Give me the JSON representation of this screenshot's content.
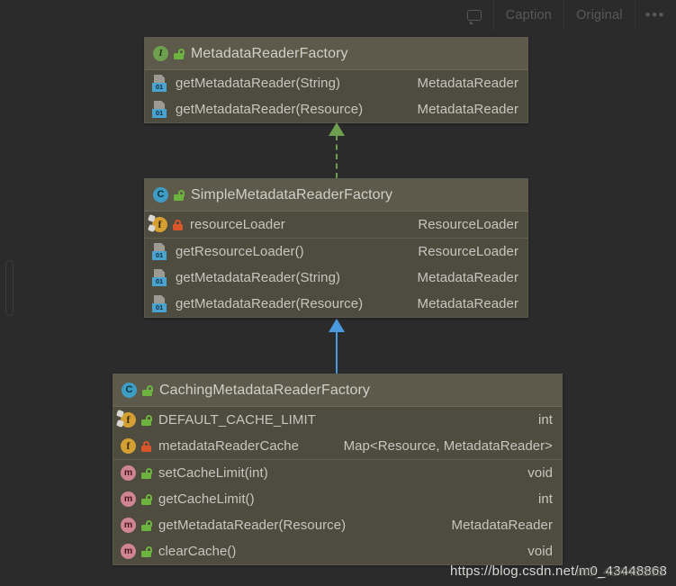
{
  "toolbar": {
    "comment_icon": "speech-bubble-icon",
    "caption_label": "Caption",
    "original_label": "Original",
    "more_label": "•••"
  },
  "watermark": {
    "url": "https://blog.csdn.net/m0_43448868",
    "ghost": "m0_43448868"
  },
  "colors": {
    "background": "#2b2b2b",
    "box_body": "#4e4b3f",
    "box_header": "#5d5a4b",
    "box_border": "#5c5a4e",
    "text": "#c6c7c0",
    "interface_icon": "#6d9f4e",
    "class_icon": "#3d9dc4",
    "field_icon": "#d4a033",
    "method_icon": "#cf8592",
    "abstract_badge": "#4aa3cf",
    "lock_public": "#6db33f",
    "lock_private": "#d9552a",
    "realization_arrow": "#6d9f4e",
    "inheritance_arrow": "#4a9ae0"
  },
  "diagram": {
    "boxes": [
      {
        "id": "metadata-reader-factory",
        "title": "MetadataReaderFactory",
        "kind_icon": "interface-icon",
        "visibility_icon": "unlocked-padlock-icon",
        "sections": [
          {
            "name": "methods",
            "members": [
              {
                "icon": "abstract-method-icon",
                "visibility_icon": "none",
                "name": "getMetadataReader(String)",
                "type": "MetadataReader"
              },
              {
                "icon": "abstract-method-icon",
                "visibility_icon": "none",
                "name": "getMetadataReader(Resource)",
                "type": "MetadataReader"
              }
            ]
          }
        ]
      },
      {
        "id": "simple-metadata-reader-factory",
        "title": "SimpleMetadataReaderFactory",
        "kind_icon": "class-icon",
        "visibility_icon": "unlocked-padlock-icon",
        "sections": [
          {
            "name": "fields",
            "members": [
              {
                "icon": "field-final-icon",
                "visibility_icon": "locked-padlock-icon",
                "name": "resourceLoader",
                "type": "ResourceLoader"
              }
            ]
          },
          {
            "name": "methods",
            "members": [
              {
                "icon": "abstract-method-icon",
                "visibility_icon": "none",
                "name": "getResourceLoader()",
                "type": "ResourceLoader"
              },
              {
                "icon": "abstract-method-icon",
                "visibility_icon": "none",
                "name": "getMetadataReader(String)",
                "type": "MetadataReader"
              },
              {
                "icon": "abstract-method-icon",
                "visibility_icon": "none",
                "name": "getMetadataReader(Resource)",
                "type": "MetadataReader"
              }
            ]
          }
        ]
      },
      {
        "id": "caching-metadata-reader-factory",
        "title": "CachingMetadataReaderFactory",
        "kind_icon": "class-icon",
        "visibility_icon": "unlocked-padlock-icon",
        "sections": [
          {
            "name": "fields",
            "members": [
              {
                "icon": "field-static-icon",
                "visibility_icon": "unlocked-padlock-icon",
                "name": "DEFAULT_CACHE_LIMIT",
                "type": "int"
              },
              {
                "icon": "field-icon",
                "visibility_icon": "locked-padlock-icon",
                "name": "metadataReaderCache",
                "type": "Map<Resource, MetadataReader>"
              }
            ]
          },
          {
            "name": "methods",
            "members": [
              {
                "icon": "method-icon",
                "visibility_icon": "unlocked-padlock-icon",
                "name": "setCacheLimit(int)",
                "type": "void"
              },
              {
                "icon": "method-icon",
                "visibility_icon": "unlocked-padlock-icon",
                "name": "getCacheLimit()",
                "type": "int"
              },
              {
                "icon": "method-icon",
                "visibility_icon": "unlocked-padlock-icon",
                "name": "getMetadataReader(Resource)",
                "type": "MetadataReader"
              },
              {
                "icon": "method-icon",
                "visibility_icon": "unlocked-padlock-icon",
                "name": "clearCache()",
                "type": "void"
              }
            ]
          }
        ]
      }
    ],
    "connectors": [
      {
        "id": "realization",
        "from": "simple-metadata-reader-factory",
        "to": "metadata-reader-factory",
        "style": "dashed",
        "arrow": "hollow-triangle-green"
      },
      {
        "id": "inheritance",
        "from": "caching-metadata-reader-factory",
        "to": "simple-metadata-reader-factory",
        "style": "solid",
        "arrow": "triangle-blue"
      }
    ]
  }
}
